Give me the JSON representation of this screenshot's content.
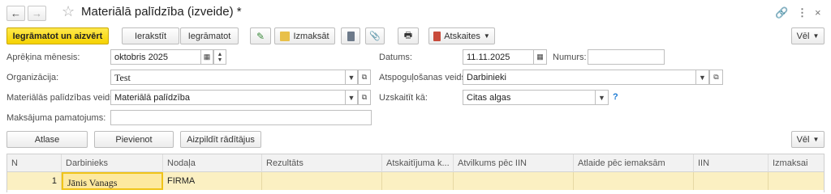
{
  "window": {
    "title": "Materiālā palīdzība (izveide) *"
  },
  "toolbar": {
    "save_close_label": "Iegrāmatot un aizvērt",
    "write_label": "Ierakstīt",
    "post_label": "Iegrāmatot",
    "payouts_label": "Izmaksāt",
    "reports_label": "Atskaites",
    "more_label": "Vēl"
  },
  "form": {
    "month_label": "Aprēķina mēnesis:",
    "month_value": "oktobris 2025",
    "date_label": "Datums:",
    "date_value": "11.11.2025",
    "number_label": "Numurs:",
    "number_value": "",
    "org_label": "Organizācija:",
    "org_value": "Test",
    "tax_type_label": "Atspoguļošanas veids:",
    "tax_type_value": "Darbinieki",
    "aid_type_label": "Materiālās palīdzības veids:",
    "aid_type_value": "Materiālā palīdzība",
    "account_label": "Uzskaitīt kā:",
    "account_value": "Citas algas",
    "payment_basis_label": "Maksājuma pamatojums:",
    "payment_basis_value": "",
    "help_mark": "?"
  },
  "table_toolbar": {
    "select_label": "Atlase",
    "add_label": "Pievienot",
    "fill_label": "Aizpildīt rādītājus",
    "more_label": "Vēl"
  },
  "table": {
    "columns": [
      "N",
      "Darbinieks",
      "Nodaļa",
      "Rezultāts",
      "Atskaitījuma k...",
      "Atvilkums pēc IIN",
      "Atlaide pēc iemaksām",
      "IIN",
      "Izmaksai"
    ],
    "rows": [
      {
        "n": "1",
        "employee": "Jānis Vanags",
        "department": "FIRMA",
        "result": "",
        "deduction_code": "",
        "deduction_after_iin": "",
        "discount": "",
        "iin": "",
        "payout": ""
      }
    ]
  },
  "colors": {
    "primary_button": "#f5d200",
    "selected_row": "#fbf0c2",
    "help": "#1a7ad4"
  }
}
